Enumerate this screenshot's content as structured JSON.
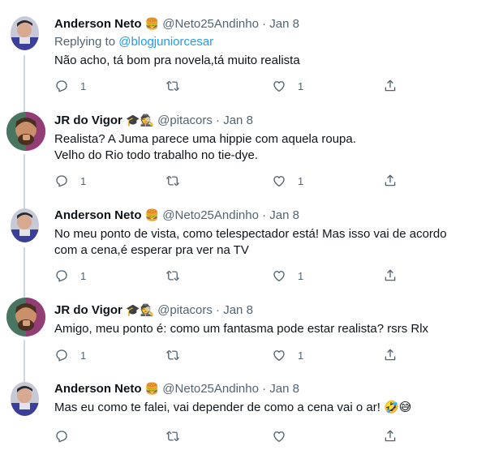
{
  "tweets": [
    {
      "name": "Anderson Neto",
      "name_emoji": "🍔",
      "handle": "@Neto25Andinho",
      "date": "Jan 8",
      "replying_prefix": "Replying to ",
      "replying_to": "@blogjuniorcesar",
      "text": "Não acho, tá bom pra novela,tá muito realista",
      "replies": "1",
      "retweets": "",
      "likes": "1"
    },
    {
      "name": "JR do Vigor",
      "name_emoji": "🎓🕵",
      "handle": "@pitacors",
      "date": "Jan 8",
      "text": "Realista? A Juma parece uma hippie com aquela roupa.\nVelho do Rio todo trabalho no tie-dye.",
      "replies": "1",
      "retweets": "",
      "likes": "1"
    },
    {
      "name": "Anderson Neto",
      "name_emoji": "🍔",
      "handle": "@Neto25Andinho",
      "date": "Jan 8",
      "text": "No meu ponto de vista, como telespectador está! Mas isso vai de acordo\ncom a cena,é esperar pra ver na TV",
      "replies": "1",
      "retweets": "",
      "likes": "1"
    },
    {
      "name": "JR do Vigor",
      "name_emoji": "🎓🕵",
      "handle": "@pitacors",
      "date": "Jan 8",
      "text": "Amigo, meu ponto é: como um fantasma pode estar realista? rsrs Rlx",
      "replies": "1",
      "retweets": "",
      "likes": "1"
    },
    {
      "name": "Anderson Neto",
      "name_emoji": "🍔",
      "handle": "@Neto25Andinho",
      "date": "Jan 8",
      "text": "Mas eu como te falei, vai depender de como a cena vai o ar! 🤣😅",
      "replies": "",
      "retweets": "",
      "likes": ""
    }
  ],
  "separator": "·",
  "colors": {
    "text": "#0f1419",
    "secondary": "#536471",
    "link": "#1d9bf0",
    "divider": "#eff3f4",
    "thread_line": "#cfd9de"
  },
  "icons": {
    "reply": "reply-icon",
    "retweet": "retweet-icon",
    "like": "heart-icon",
    "share": "share-icon"
  }
}
